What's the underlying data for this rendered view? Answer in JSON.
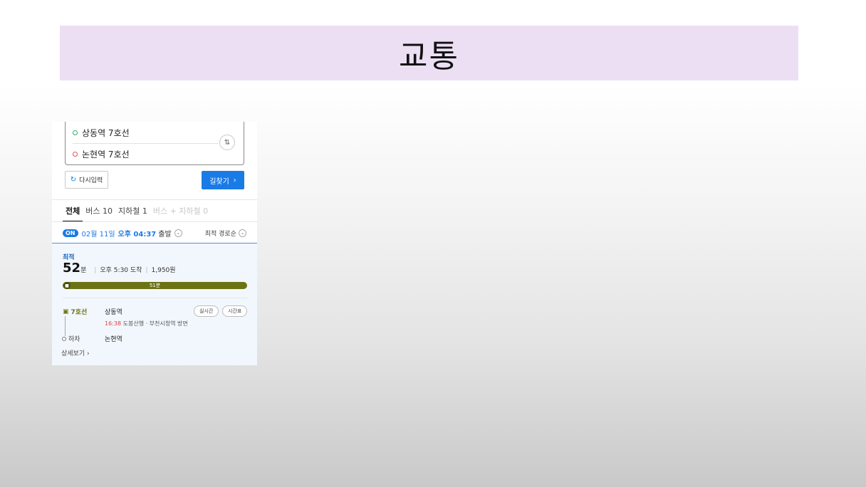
{
  "slide": {
    "title": "교통"
  },
  "search": {
    "start": "상동역 7호선",
    "end": "논현역 7호선",
    "reset_label": "다시입력",
    "search_label": "길찾기"
  },
  "tabs": [
    {
      "label": "전체"
    },
    {
      "label": "버스 10"
    },
    {
      "label": "지하철 1"
    },
    {
      "label": "버스 + 지하철 0"
    }
  ],
  "departure": {
    "badge": "ON",
    "date": "02월 11일",
    "time": "오후 04:37",
    "label": "출발",
    "sort": "최적 경로순"
  },
  "result": {
    "badge": "최적",
    "minutes": "52",
    "minutes_unit": "분",
    "arrival": "오후 5:30 도착",
    "fare": "1,950원",
    "bar_text": "51분",
    "line": "7호선",
    "board_station": "상동역",
    "realtime_label": "실시간",
    "timetable_label": "시간표",
    "next_time": "16:38",
    "direction": "도봉산행 · 부천시청역 방면",
    "alight_label": "하차",
    "alight_station": "논현역",
    "detail_label": "상세보기"
  }
}
